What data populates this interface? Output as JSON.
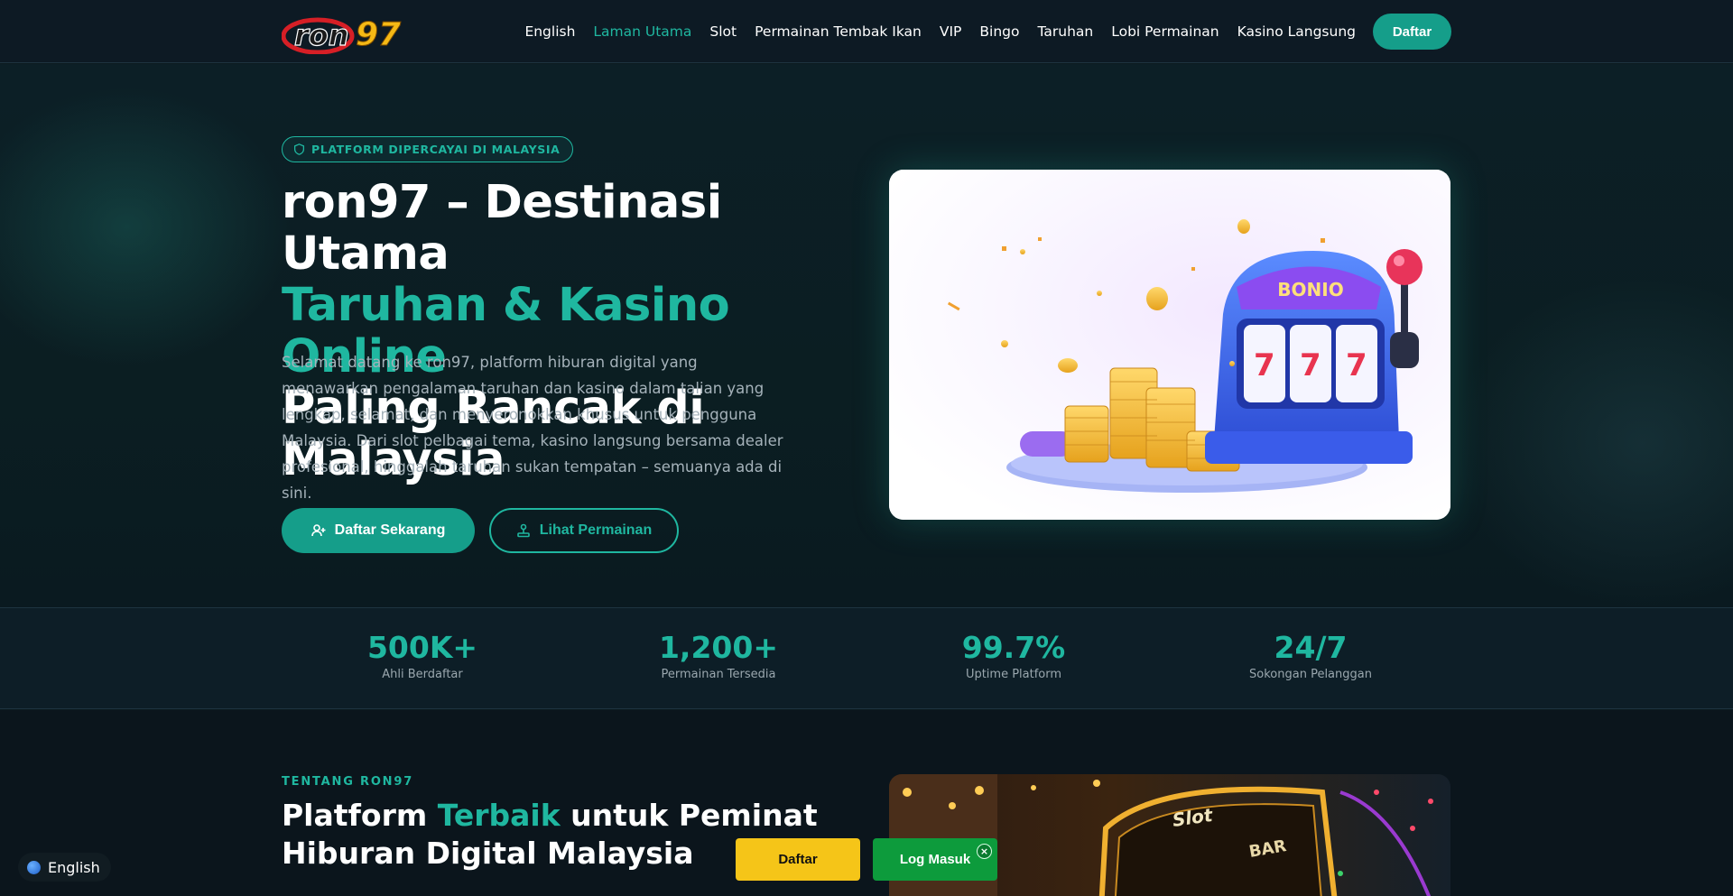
{
  "nav": {
    "logo_alt": "ron97",
    "links": [
      "English",
      "Laman Utama",
      "Slot",
      "Permainan Tembak Ikan",
      "VIP",
      "Bingo",
      "Taruhan",
      "Lobi Permainan",
      "Kasino Langsung"
    ],
    "active_index": 1,
    "cta": "Daftar"
  },
  "hero": {
    "badge": "PLATFORM DIPERCAYAI DI MALAYSIA",
    "title_line1": "ron97 – Destinasi Utama",
    "title_line2": "Taruhan & Kasino Online",
    "title_line3": "Paling Rancak di Malaysia",
    "description": "Selamat datang ke ron97, platform hiburan digital yang menawarkan pengalaman taruhan dan kasino dalam talian yang lengkap, selamat, dan menyeronokkan khusus untuk pengguna Malaysia. Dari slot pelbagai tema, kasino langsung bersama dealer profesional, hinggalah taruhan sukan tempatan – semuanya ada di sini.",
    "btn_primary": "Daftar Sekarang",
    "btn_secondary": "Lihat Permainan",
    "image_label": "BONIO"
  },
  "stats": [
    {
      "value": "500K+",
      "label": "Ahli Berdaftar"
    },
    {
      "value": "1,200+",
      "label": "Permainan Tersedia"
    },
    {
      "value": "99.7%",
      "label": "Uptime Platform"
    },
    {
      "value": "24/7",
      "label": "Sokongan Pelanggan"
    }
  ],
  "about": {
    "eyebrow": "TENTANG RON97",
    "title_pre": "Platform ",
    "title_accent": "Terbaik",
    "title_post": " untuk Peminat",
    "title_line2": "Hiburan Digital Malaysia",
    "image_sign": "Slot",
    "image_sign2": "BAR"
  },
  "floating": {
    "language": "English",
    "daftar": "Daftar",
    "login": "Log Masuk",
    "close": "×"
  },
  "colors": {
    "accent": "#1fb7a0",
    "background": "#0b1a1f",
    "daftar_yellow": "#f5c518",
    "login_green": "#0d9b3c"
  }
}
